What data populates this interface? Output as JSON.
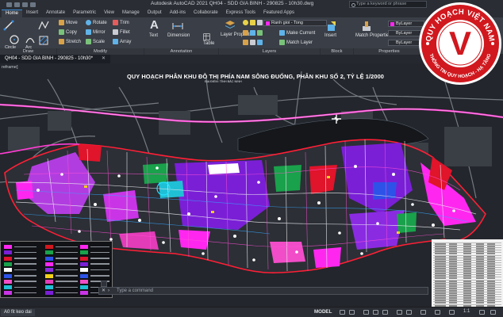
{
  "app": {
    "title": "Autodesk AutoCAD 2021   QH04 - SDD GIA BINH -  290825 - 10h30.dwg",
    "search_placeholder": "Type a keyword or phrase"
  },
  "ribbon_tabs": [
    "Home",
    "Insert",
    "Annotate",
    "Parametric",
    "View",
    "Manage",
    "Output",
    "Add-ins",
    "Collaborate",
    "Express Tools",
    "Featured Apps"
  ],
  "ribbon": {
    "draw": {
      "title": "Draw",
      "line": "Line",
      "polyline": "Polyline",
      "circle": "Circle",
      "arc": "Arc"
    },
    "modify": {
      "title": "Modify",
      "move": "Move",
      "rotate": "Rotate",
      "trim": "Trim",
      "copy": "Copy",
      "mirror": "Mirror",
      "fillet": "Fillet",
      "stretch": "Stretch",
      "scale": "Scale",
      "array": "Array"
    },
    "annotation": {
      "title": "Annotation",
      "text": "Text",
      "dimension": "Dimension",
      "table": "Table"
    },
    "layers": {
      "title": "Layers",
      "layer_properties": "Layer Properties",
      "current_layer": "Ranh gioi - Tong",
      "make_current": "Make Current",
      "match_layer": "Match Layer"
    },
    "block": {
      "title": "Block",
      "insert": "Insert"
    },
    "properties": {
      "title": "Properties",
      "match_properties": "Match Properties",
      "color": "ByLayer",
      "linetype": "ByLayer",
      "lineweight": "ByLayer"
    }
  },
  "document_tab": "QH04 - SDD GIA BINH -  290825 - 10h30*",
  "drawing": {
    "view_label": "reframe]",
    "plan_title": "QUY HOẠCH PHÂN KHU ĐÔ THỊ PHÍA NAM  SÔNG ĐUỐNG, PHÂN KHU SỐ 2, TỶ LỆ 1/2000",
    "plan_subtitle": "ĐỊA ĐIỂM: TỈNH BẮC NINH",
    "command_placeholder": "Type a command"
  },
  "statusbar": {
    "layout_tab": "A0 fit keo dai",
    "model": "MODEL",
    "scale": "1:1"
  },
  "logo": {
    "letter": "V",
    "text_top": "QUY HOẠCH VIỆT NAM",
    "text_bottom": "THÔNG TIN QUY HOẠCH - HẠ TẦNG"
  },
  "colors": {
    "ribbon_bg": "#3a3e46",
    "canvas_bg": "#23262c",
    "accent": "#3b8bd6",
    "logo_red": "#d0181e",
    "plan_purple": "#7a1fd6",
    "plan_magenta": "#ff27f0",
    "plan_pink": "#f24dc8",
    "plan_red": "#e0142a"
  }
}
